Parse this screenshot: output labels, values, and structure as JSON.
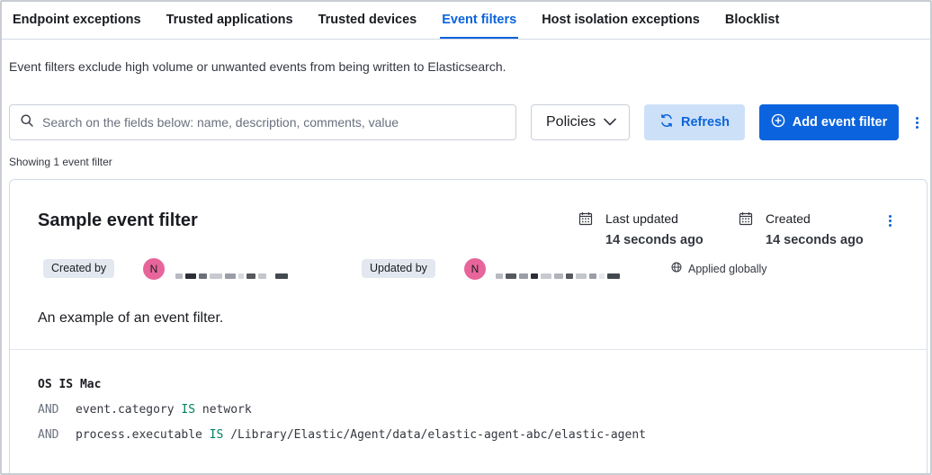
{
  "tabs": [
    {
      "label": "Endpoint exceptions",
      "active": false
    },
    {
      "label": "Trusted applications",
      "active": false
    },
    {
      "label": "Trusted devices",
      "active": false
    },
    {
      "label": "Event filters",
      "active": true
    },
    {
      "label": "Host isolation exceptions",
      "active": false
    },
    {
      "label": "Blocklist",
      "active": false
    }
  ],
  "description": "Event filters exclude high volume or unwanted events from being written to Elasticsearch.",
  "toolbar": {
    "search_placeholder": "Search on the fields below: name, description, comments, value",
    "search_value": "",
    "policies_label": "Policies",
    "refresh_label": "Refresh",
    "add_label": "Add event filter",
    "icons": {
      "search": "search-icon",
      "policies": "chevron-down-icon",
      "refresh": "refresh-icon",
      "add": "plus-circle-icon",
      "more": "vertical-dots-icon"
    }
  },
  "showing_text": "Showing 1 event filter",
  "card": {
    "title": "Sample event filter",
    "last_updated_label": "Last updated",
    "last_updated_value": "14 seconds ago",
    "created_label": "Created",
    "created_value": "14 seconds ago",
    "created_by_label": "Created by",
    "created_by_initial": "N",
    "updated_by_label": "Updated by",
    "updated_by_initial": "N",
    "applied_label": "Applied globally",
    "description": "An example of an event filter.",
    "criteria": [
      {
        "prefix": "",
        "field": "OS",
        "operator": "IS",
        "value": "Mac"
      },
      {
        "prefix": "AND",
        "field": "event.category",
        "operator": "IS",
        "value": "network"
      },
      {
        "prefix": "AND",
        "field": "process.executable",
        "operator": "IS",
        "value": "/Library/Elastic/Agent/data/elastic-agent-abc/elastic-agent"
      }
    ]
  },
  "colors": {
    "primary": "#0b64dd",
    "refresh_bg": "#cce1f8",
    "avatar": "#e7659a",
    "operator": "#00805e",
    "badge_bg": "#e3e8f0"
  }
}
